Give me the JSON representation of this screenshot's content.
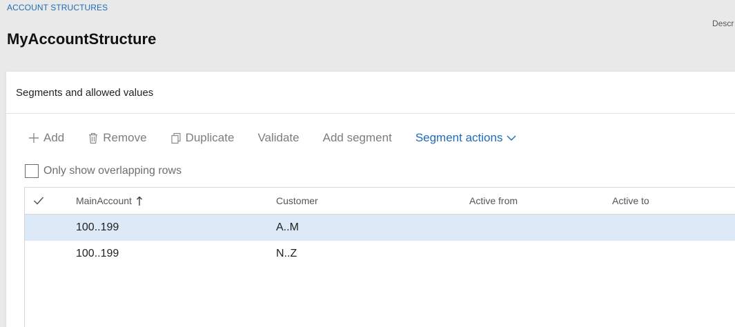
{
  "breadcrumb": "ACCOUNT STRUCTURES",
  "page_title": "MyAccountStructure",
  "description_label": "Descr",
  "card": {
    "title": "Segments and allowed values"
  },
  "toolbar": {
    "add_label": "Add",
    "remove_label": "Remove",
    "duplicate_label": "Duplicate",
    "validate_label": "Validate",
    "add_segment_label": "Add segment",
    "segment_actions_label": "Segment actions"
  },
  "filter": {
    "overlap_label": "Only show overlapping rows",
    "overlap_checked": false
  },
  "grid": {
    "columns": {
      "main_account": "MainAccount",
      "customer": "Customer",
      "active_from": "Active from",
      "active_to": "Active to"
    },
    "sort": {
      "column": "MainAccount",
      "direction": "ascending"
    },
    "rows": [
      {
        "main_account": "100..199",
        "customer": "A..M",
        "active_from": "",
        "active_to": "",
        "selected": true
      },
      {
        "main_account": "100..199",
        "customer": "N..Z",
        "active_from": "",
        "active_to": "",
        "selected": false
      }
    ]
  },
  "colors": {
    "accent": "#1e6bb8",
    "selected_row": "#dce9f6",
    "page_background": "#e9e9e9",
    "disabled_text": "#7d7d7d"
  },
  "icons": {
    "add": "plus-icon",
    "remove": "trash-icon",
    "duplicate": "copy-icon",
    "segment_actions": "chevron-down-icon",
    "select_all": "checkmark-icon",
    "sort": "arrow-up-icon"
  }
}
